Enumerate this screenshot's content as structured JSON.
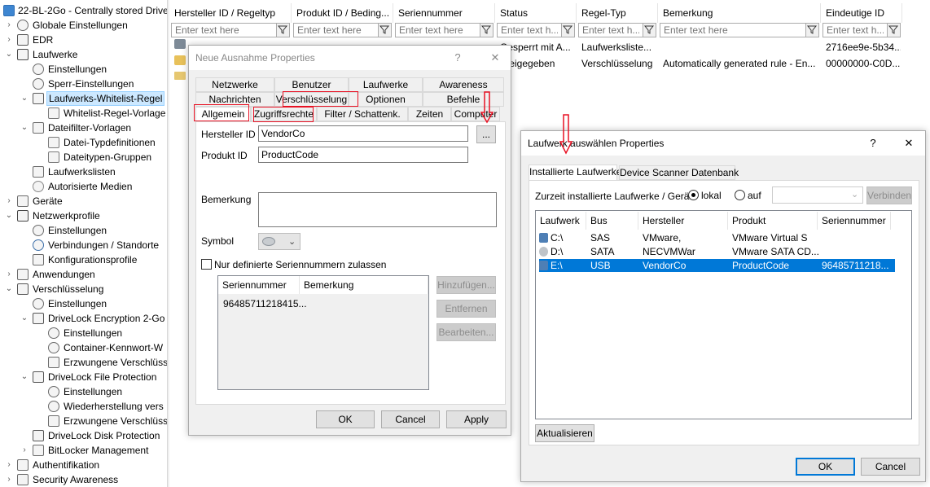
{
  "tree": {
    "items": [
      {
        "label": "22-BL-2Go - Centrally stored Drive",
        "depth": 0,
        "icon": "computer-icon",
        "expander": ""
      },
      {
        "label": "Globale Einstellungen",
        "depth": 1,
        "icon": "gears-icon",
        "expander": "›"
      },
      {
        "label": "EDR",
        "depth": 1,
        "icon": "radar-icon",
        "expander": "›"
      },
      {
        "label": "Laufwerke",
        "depth": 1,
        "icon": "drive-icon",
        "expander": "⌄"
      },
      {
        "label": "Einstellungen",
        "depth": 2,
        "icon": "gear-icon",
        "expander": ""
      },
      {
        "label": "Sperr-Einstellungen",
        "depth": 2,
        "icon": "gears-icon",
        "expander": ""
      },
      {
        "label": "Laufwerks-Whitelist-Regel",
        "depth": 2,
        "icon": "usb-icon",
        "expander": "⌄",
        "selected": true
      },
      {
        "label": "Whitelist-Regel-Vorlage",
        "depth": 3,
        "icon": "document-icon",
        "expander": ""
      },
      {
        "label": "Dateifilter-Vorlagen",
        "depth": 2,
        "icon": "filter-icon",
        "expander": "⌄"
      },
      {
        "label": "Datei-Typdefinitionen",
        "depth": 3,
        "icon": "document-icon",
        "expander": ""
      },
      {
        "label": "Dateitypen-Gruppen",
        "depth": 3,
        "icon": "document-icon",
        "expander": ""
      },
      {
        "label": "Laufwerkslisten",
        "depth": 2,
        "icon": "list-icon",
        "expander": ""
      },
      {
        "label": "Autorisierte Medien",
        "depth": 2,
        "icon": "disc-icon",
        "expander": ""
      },
      {
        "label": "Geräte",
        "depth": 1,
        "icon": "device-icon",
        "expander": "›"
      },
      {
        "label": "Netzwerkprofile",
        "depth": 1,
        "icon": "network-icon",
        "expander": "⌄"
      },
      {
        "label": "Einstellungen",
        "depth": 2,
        "icon": "gear-icon",
        "expander": ""
      },
      {
        "label": "Verbindungen / Standorte",
        "depth": 2,
        "icon": "globe-icon",
        "expander": ""
      },
      {
        "label": "Konfigurationsprofile",
        "depth": 2,
        "icon": "profile-icon",
        "expander": ""
      },
      {
        "label": "Anwendungen",
        "depth": 1,
        "icon": "app-icon",
        "expander": "›"
      },
      {
        "label": "Verschlüsselung",
        "depth": 1,
        "icon": "lock-icon",
        "expander": "⌄"
      },
      {
        "label": "Einstellungen",
        "depth": 2,
        "icon": "gear-icon",
        "expander": ""
      },
      {
        "label": "DriveLock Encryption 2-Go",
        "depth": 2,
        "icon": "safe-icon",
        "expander": "⌄"
      },
      {
        "label": "Einstellungen",
        "depth": 3,
        "icon": "gear-icon",
        "expander": ""
      },
      {
        "label": "Container-Kennwort-W",
        "depth": 3,
        "icon": "gear-icon",
        "expander": ""
      },
      {
        "label": "Erzwungene Verschlüss",
        "depth": 3,
        "icon": "window-icon",
        "expander": ""
      },
      {
        "label": "DriveLock File Protection",
        "depth": 2,
        "icon": "lock-icon",
        "expander": "⌄"
      },
      {
        "label": "Einstellungen",
        "depth": 3,
        "icon": "gear-icon",
        "expander": ""
      },
      {
        "label": "Wiederherstellung vers",
        "depth": 3,
        "icon": "gear-icon",
        "expander": ""
      },
      {
        "label": "Erzwungene Verschlüss",
        "depth": 3,
        "icon": "window-icon",
        "expander": ""
      },
      {
        "label": "DriveLock Disk Protection",
        "depth": 2,
        "icon": "disk-icon",
        "expander": ""
      },
      {
        "label": "BitLocker Management",
        "depth": 2,
        "icon": "bitlocker-icon",
        "expander": "›"
      },
      {
        "label": "Authentifikation",
        "depth": 1,
        "icon": "auth-icon",
        "expander": "›"
      },
      {
        "label": "Security Awareness",
        "depth": 1,
        "icon": "awareness-icon",
        "expander": "›"
      }
    ]
  },
  "grid": {
    "columns": [
      "Hersteller ID / Regeltyp",
      "Produkt ID / Beding...",
      "Seriennummer",
      "Status",
      "Regel-Typ",
      "Bemerkung",
      "Eindeutige ID"
    ],
    "filter_placeholder": "Enter text here",
    "filter_placeholder_short": "Enter text h...",
    "rows": [
      {
        "cells": [
          "",
          "",
          "",
          "Gesperrt mit A...",
          "Laufwerksliste...",
          "",
          "2716ee9e-5b34..."
        ]
      },
      {
        "cells": [
          "",
          "",
          "",
          "Freigegeben",
          "Verschlüsselung",
          "Automatically generated rule - En...",
          "00000000-C0D..."
        ]
      }
    ]
  },
  "exception_dialog": {
    "title": "Neue Ausnahme Properties",
    "help": "?",
    "close": "✕",
    "tabs_row1": [
      "Netzwerke",
      "Benutzer",
      "Laufwerke",
      "Awareness"
    ],
    "tabs_row2": [
      "Nachrichten",
      "Verschlüsselung",
      "Optionen",
      "Befehle"
    ],
    "tabs_row3": [
      "Allgemein",
      "Zugriffsrechte",
      "Filter / Schattenk.",
      "Zeiten",
      "Computer"
    ],
    "vendor_label": "Hersteller ID",
    "vendor_value": "VendorCo",
    "browse_label": "...",
    "product_label": "Produkt ID",
    "product_value": "ProductCode",
    "remark_label": "Bemerkung",
    "remark_value": "",
    "symbol_label": "Symbol",
    "serial_only_label": "Nur definierte Seriennummern zulassen",
    "serial_columns": [
      "Seriennummer",
      "Bemerkung"
    ],
    "serial_rows": [
      "96485711218415..."
    ],
    "add_label": "Hinzufügen...",
    "remove_label": "Entfernen",
    "edit_label": "Bearbeiten...",
    "ok_label": "OK",
    "cancel_label": "Cancel",
    "apply_label": "Apply"
  },
  "drive_dialog": {
    "title": "Laufwerk auswählen Properties",
    "help": "?",
    "close": "✕",
    "tabs": [
      "Installierte Laufwerke",
      "Device Scanner Datenbank"
    ],
    "installed_label": "Zurzeit installierte Laufwerke / Geräte",
    "radio_local": "lokal",
    "radio_on": "auf",
    "connect_label": "Verbinden",
    "columns": [
      "Laufwerk",
      "Bus",
      "Hersteller",
      "Produkt",
      "Seriennummer"
    ],
    "rows": [
      {
        "cells": [
          "C:\\",
          "SAS",
          "VMware,",
          "VMware Virtual S",
          ""
        ],
        "icon": "disk-icon"
      },
      {
        "cells": [
          "D:\\",
          "SATA",
          "NECVMWar",
          "VMware SATA CD...",
          ""
        ],
        "icon": "cdrom-icon"
      },
      {
        "cells": [
          "E:\\",
          "USB",
          "VendorCo",
          "ProductCode",
          "96485711218..."
        ],
        "icon": "usb-drive-icon",
        "selected": true
      }
    ],
    "refresh_label": "Aktualisieren",
    "ok_label": "OK",
    "cancel_label": "Cancel"
  },
  "colors": {
    "accent": "#0078d7",
    "highlight_red": "#e81123",
    "selection": "#cce8ff"
  }
}
